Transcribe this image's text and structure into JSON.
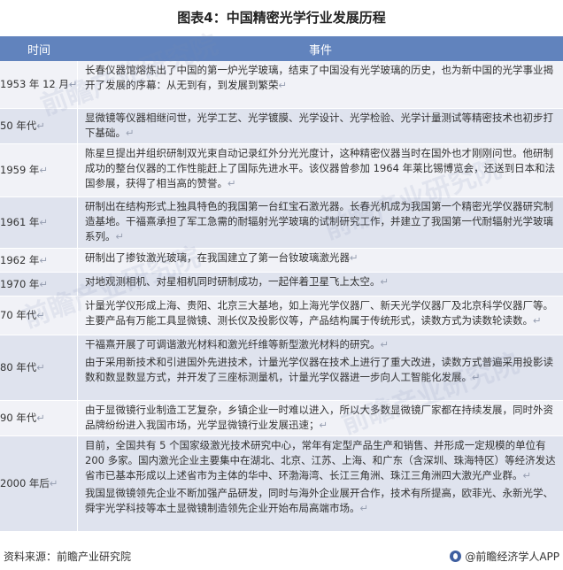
{
  "title": "图表4：中国精密光学行业发展历程",
  "header": {
    "time": "时间",
    "event": "事件"
  },
  "return_mark": "↵",
  "rows": [
    {
      "time": "1953 年 12 月",
      "height": 54,
      "events": [
        "长春仪器馆熔炼出了中国的第一炉光学玻璃，结束了中国没有光学玻璃的历史，也为新中国的光学事业揭开了发展的序幕：从无到有，到发展到繁荣"
      ]
    },
    {
      "time": "50 年代",
      "height": 40,
      "events": [
        "显微镜等仪器相继问世，光学工艺、光学镀膜、光学设计、光学检验、光学计量测试等精密技术也初步打下基础。"
      ]
    },
    {
      "time": "1959 年",
      "height": 60,
      "events": [
        "陈星旦提出并组织研制双光束自动记录红外分光光度计，这种精密仪器当时在国外也才刚刚问世。他研制成功的整台仪器的工作性能赶上了国际先进水平。该仪器曾参加 1964 年莱比锡博览会，还送到日本和法国参展，获得了相当高的赞誉。"
      ]
    },
    {
      "time": "1961 年",
      "height": 58,
      "events": [
        "研制出在结构形式上独具特色的我国第一台红宝石激光器。长春光机成为我国第一个精密光学仪器研究制造基地。干福熹承担了军工急需的耐辐射光学玻璃的试制研究工作，并建立了我国第一代耐辐射光学玻璃系列。"
      ]
    },
    {
      "time": "1962 年",
      "height": 27,
      "events": [
        "研制出了掺钕激光玻璃，在我国建立了第一台钕玻璃激光器"
      ]
    },
    {
      "time": "1970 年",
      "height": 27,
      "events": [
        "对地观测相机、对星相机同时研制成功，一起伴着卫星飞上太空。"
      ]
    },
    {
      "time": "70 年代",
      "height": 44,
      "events": [
        "计量光学仪形成上海、贵阳、北京三大基地，如上海光学仪器厂、新天光学仪器厂及北京科学仪器厂等。主要产品有万能工具显微镜、测长仪及投影仪等，产品结构属于传统形式，读数方式为读数轮读数。"
      ]
    },
    {
      "time": "80 年代",
      "height": 74,
      "events": [
        "干福熹开展了可调谐激光材料和激光纤维等新型激光材料的研究。",
        "由于采用新技术和引进国外先进技术，计量光学仪器在技术上进行了重大改进，读数方式普遍采用投影读数和数显数显方式，并开发了三座标测量机，计量光学仪器进一步向人工智能化发展。"
      ]
    },
    {
      "time": "90 年代",
      "height": 40,
      "events": [
        "由于显微镜行业制造工艺复杂，乡镇企业一时难以进入，所以大多数显微镜厂家都在持续发展，同时外资品牌纷纷进入我国市场，光学显微镜行业发展迅速；"
      ]
    },
    {
      "time": "2000 年后",
      "height": 108,
      "events": [
        "目前，全国共有 5 个国家级激光技术研究中心，常年有定型产品生产和销售、并形成一定规模的单位有 200 多家。国内激光企业主要集中在湖北、北京、江苏、上海、和广东（含深圳、珠海特区）等经济发达省市已基本形成以上述省市为主体的华中、环渤海湾、长江三角洲、珠江三角洲四大激光产业群。",
        "我国显微镜领先企业不断加强产品研发，同时与海外企业展开合作，技术有所提高，欧菲光、永新光学、舜宇光学科技等本土显微镜制造领先企业开始布局高端市场。"
      ]
    }
  ],
  "footer": {
    "source": "资料来源：前瞻产业研究院",
    "brand": "@前瞻经济学人APP"
  },
  "watermark": "前瞻产业研究院"
}
